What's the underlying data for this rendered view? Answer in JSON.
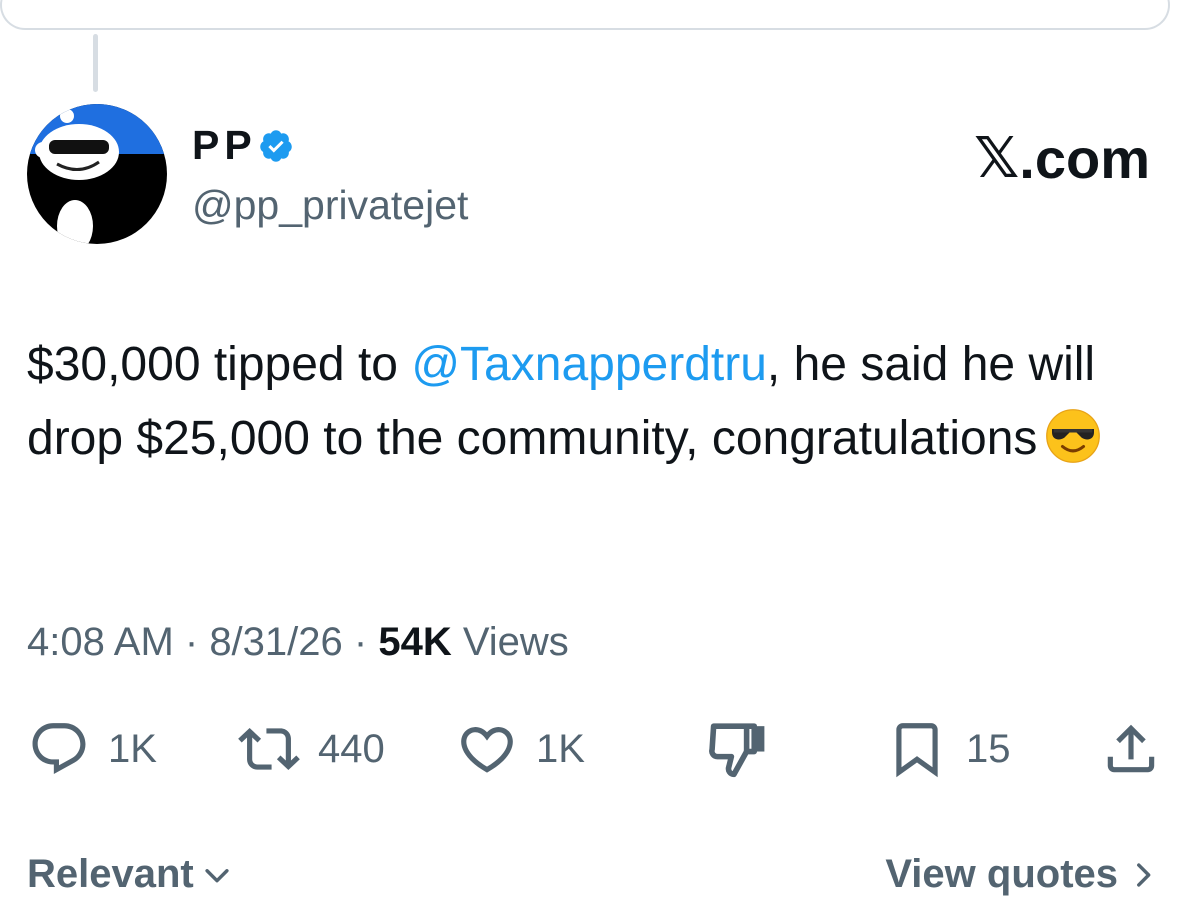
{
  "author": {
    "display_name": "PP",
    "handle": "@pp_privatejet",
    "verified": true
  },
  "site_logo": {
    "glyph": "𝕏",
    "text": ".com"
  },
  "tweet": {
    "text_before_mention": "$30,000 tipped to ",
    "mention": "@Taxnapperdtru",
    "text_after_mention": ", he said he will drop $25,000 to the community, congratulations",
    "emoji": "smiling-face-with-sunglasses"
  },
  "meta": {
    "time": "4:08 AM",
    "separator": " · ",
    "date": "8/31/26",
    "views_count": "54K",
    "views_label": " Views"
  },
  "actions": {
    "replies": "1K",
    "reposts": "440",
    "likes": "1K",
    "bookmarks": "15"
  },
  "footer": {
    "sort_label": "Relevant",
    "quotes_link": "View quotes"
  },
  "colors": {
    "text_primary": "#0f1419",
    "text_secondary": "#536471",
    "accent_link": "#1d9bf0",
    "verified_badge": "#1d9bf0"
  },
  "icons": {
    "reply": "speech-bubble-icon",
    "repost": "repost-arrows-icon",
    "like": "heart-icon",
    "dislike": "thumbs-down-icon",
    "bookmark": "bookmark-icon",
    "share": "share-upload-icon"
  }
}
